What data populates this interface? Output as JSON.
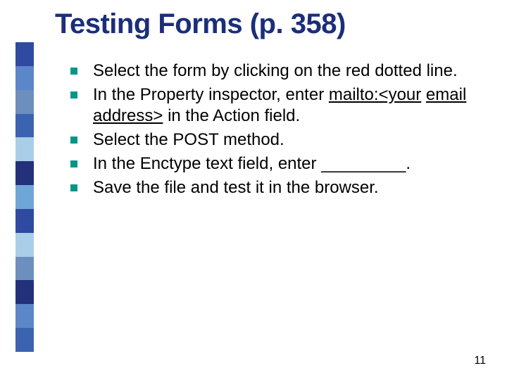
{
  "title": "Testing Forms (p. 358)",
  "page_number": "11",
  "bullets": [
    {
      "html": "Select the form by clicking on the red dotted line."
    },
    {
      "html": "In the Property inspector, enter <span class=\"underline\">mailto:&lt;your</span> <span class=\"underline\">email address&gt;</span> in the Action field."
    },
    {
      "html": "Select the POST method."
    },
    {
      "html": "In the Enctype text field, enter _________."
    },
    {
      "html": "Save the file and test it in the browser."
    }
  ]
}
